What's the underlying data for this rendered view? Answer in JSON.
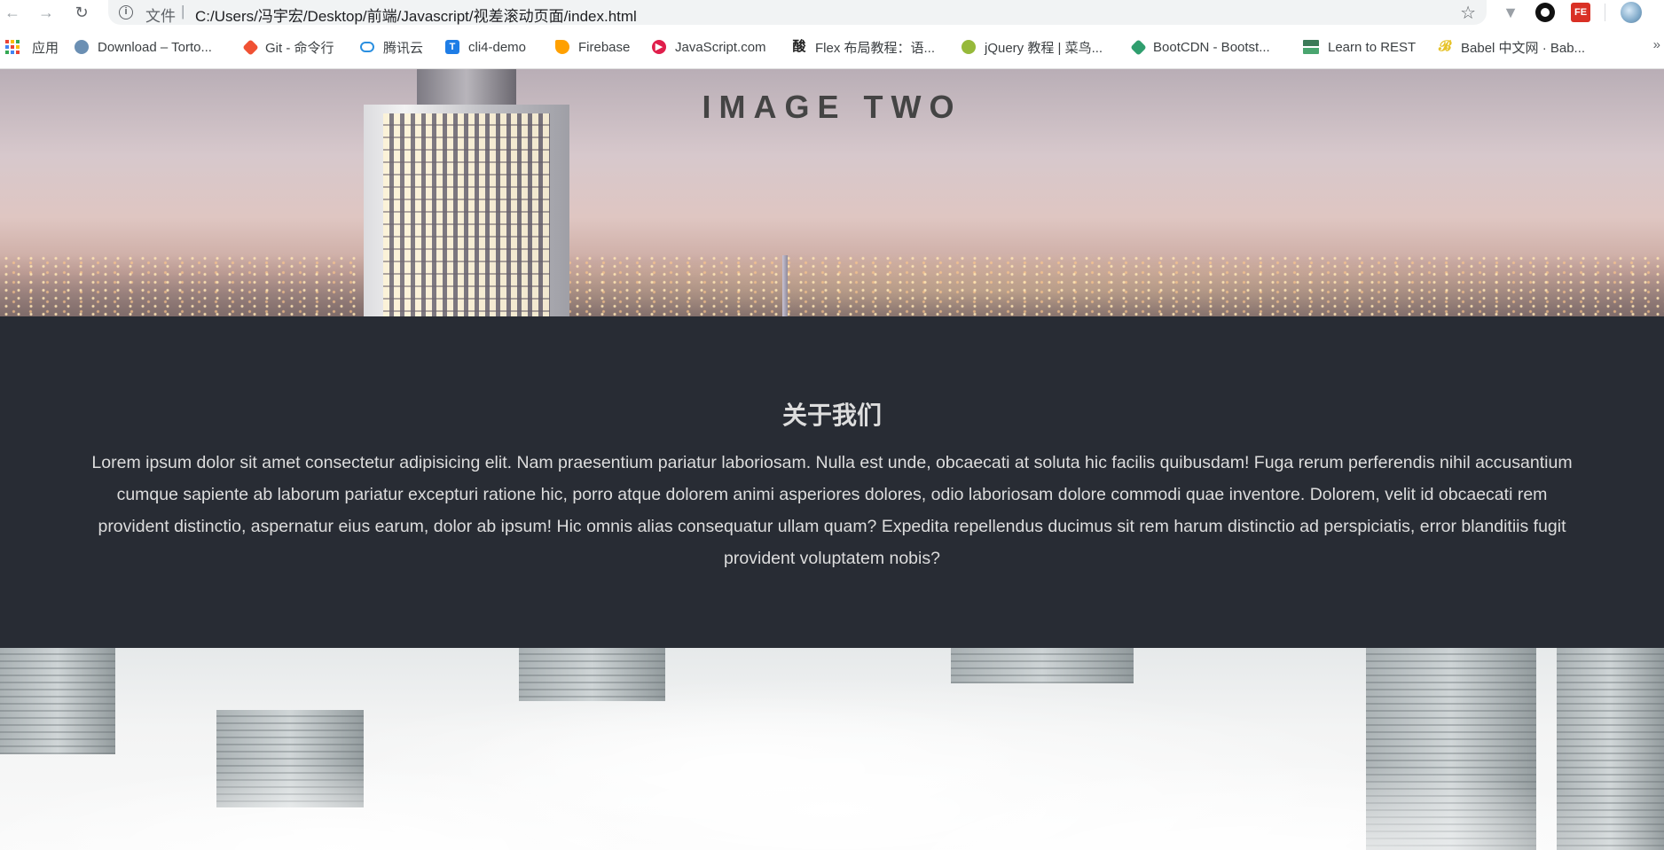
{
  "browser": {
    "scheme_label": "文件",
    "separator": "|",
    "url": "C:/Users/冯宇宏/Desktop/前端/Javascript/视差滚动页面/index.html",
    "nav_icons": [
      "back-arrow-icon",
      "forward-arrow-icon",
      "reload-icon"
    ],
    "extension_fe_label": "FE",
    "bookmarks": [
      {
        "label": "应用",
        "icon": "apps-grid-icon"
      },
      {
        "label": "Download – Torto...",
        "icon": "tortoise-icon",
        "color": "#6b8fb3"
      },
      {
        "label": "Git - 命令行",
        "icon": "git-icon",
        "color": "#f05133"
      },
      {
        "label": "腾讯云",
        "icon": "tencent-cloud-icon",
        "color": "#2a8fe0"
      },
      {
        "label": "cli4-demo",
        "icon": "t-icon",
        "color": "#1e7de6"
      },
      {
        "label": "Firebase",
        "icon": "firebase-icon",
        "color": "#ffa000"
      },
      {
        "label": "JavaScript.com",
        "icon": "javascript-icon",
        "color": "#e01e4b"
      },
      {
        "label": "Flex 布局教程：语...",
        "icon": "ruanyifeng-icon",
        "color": "#222222"
      },
      {
        "label": "jQuery 教程 | 菜鸟...",
        "icon": "runoob-icon",
        "color": "#96b93a"
      },
      {
        "label": "BootCDN - Bootst...",
        "icon": "bootcdn-icon",
        "color": "#2f9e6e"
      },
      {
        "label": "Learn to REST",
        "icon": "rest-icon",
        "color": "#3b7a57"
      },
      {
        "label": "Babel 中文网 · Bab...",
        "icon": "babel-icon",
        "color": "#e6c229"
      }
    ],
    "more_bookmarks": "»"
  },
  "page": {
    "hero_title": "IMAGE TWO",
    "about_title": "关于我们",
    "about_text": "Lorem ipsum dolor sit amet consectetur adipisicing elit. Nam praesentium pariatur laboriosam. Nulla est unde, obcaecati at soluta hic facilis quibusdam! Fuga rerum perferendis nihil accusantium cumque sapiente ab laborum pariatur excepturi ratione hic, porro atque dolorem animi asperiores dolores, odio laboriosam dolore commodi quae inventore. Dolorem, velit id obcaecati rem provident distinctio, aspernatur eius earum, dolor ab ipsum! Hic omnis alias consequatur ullam quam? Expedita repellendus ducimus sit rem harum distinctio ad perspiciatis, error blanditiis fugit provident voluptatem nobis?"
  }
}
